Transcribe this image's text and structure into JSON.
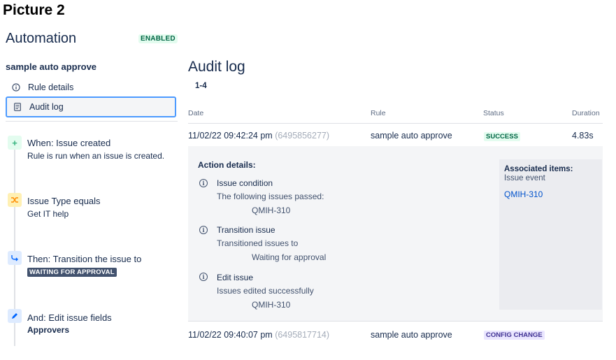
{
  "caption": "Picture 2",
  "sidebar": {
    "title": "Automation",
    "status_badge": "ENABLED",
    "rule_name": "sample auto approve",
    "nav": [
      {
        "label": "Rule details",
        "icon": "info-icon"
      },
      {
        "label": "Audit log",
        "icon": "document-icon",
        "active": true
      }
    ],
    "steps": [
      {
        "title": "When: Issue created",
        "sub": "Rule is run when an issue is created.",
        "icon": "plus-icon",
        "color": "#36b37e"
      },
      {
        "title": "Issue Type equals",
        "sub": "Get IT help",
        "icon": "shuffle-icon",
        "color": "#ffab00"
      },
      {
        "title": "Then: Transition the issue to",
        "badge": "WAITING FOR APPROVAL",
        "icon": "transition-icon",
        "color": "#0065ff"
      },
      {
        "title": "And: Edit issue fields",
        "bold_sub": "Approvers",
        "icon": "pencil-icon",
        "color": "#0065ff"
      }
    ]
  },
  "main": {
    "title": "Audit log",
    "range": "1-4",
    "columns": [
      "Date",
      "Rule",
      "Status",
      "Duration"
    ],
    "rows": [
      {
        "date": "11/02/22 09:42:24 pm",
        "exec_id": "(6495856277)",
        "rule": "sample auto approve",
        "status": "SUCCESS",
        "duration": "4.83s"
      },
      {
        "date": "11/02/22 09:40:07 pm",
        "exec_id": "(6495817714)",
        "rule": "sample auto approve",
        "status": "CONFIG CHANGE",
        "duration": ""
      }
    ],
    "details": {
      "label": "Action details:",
      "actions": [
        {
          "title": "Issue condition",
          "desc": "The following issues passed:",
          "value": "QMIH-310"
        },
        {
          "title": "Transition issue",
          "desc": "Transitioned issues to",
          "value": "Waiting for approval"
        },
        {
          "title": "Edit issue",
          "desc": "Issues edited successfully",
          "value": "QMIH-310"
        }
      ],
      "associated": {
        "title": "Associated items:",
        "sub": "Issue event",
        "link": "QMIH-310"
      }
    }
  },
  "colors": {
    "success": "#006644",
    "config": "#403294",
    "link": "#0052cc",
    "focus": "#4c9aff"
  }
}
